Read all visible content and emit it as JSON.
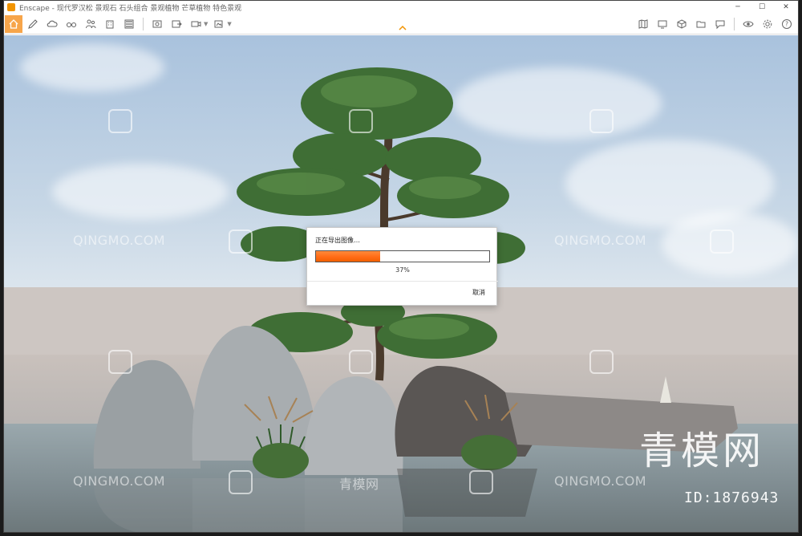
{
  "window": {
    "title": "Enscape - 现代罗汉松 景观石 石头组合 景观植物 芒草植物 特色景观",
    "controls": {
      "minimize": "─",
      "maximize": "☐",
      "close": "✕"
    }
  },
  "toolbar": {
    "left_icons": [
      "home-icon",
      "pencil-icon",
      "cloud-icon",
      "glasses-icon",
      "people-icon",
      "building-icon",
      "layers-icon",
      "screenshot-icon",
      "export-icon",
      "video-icon",
      "panorama-icon"
    ],
    "right_icons": [
      "map-icon",
      "monitor-icon",
      "cube-icon",
      "folder-icon",
      "chat-icon",
      "eye-icon",
      "gear-icon",
      "help-icon"
    ],
    "help_label": "?"
  },
  "dialog": {
    "title": "正在导出图像…",
    "progress": 0.37,
    "progress_text": "37%",
    "cancel_label": "取消"
  },
  "watermarks": {
    "site_text": "QINGMO.COM",
    "cn_text": "青模网",
    "big_logo": "青模网",
    "id_label": "ID:1876943"
  },
  "colors": {
    "accent": "#f29400",
    "progress_fill": "#ff6a14"
  }
}
